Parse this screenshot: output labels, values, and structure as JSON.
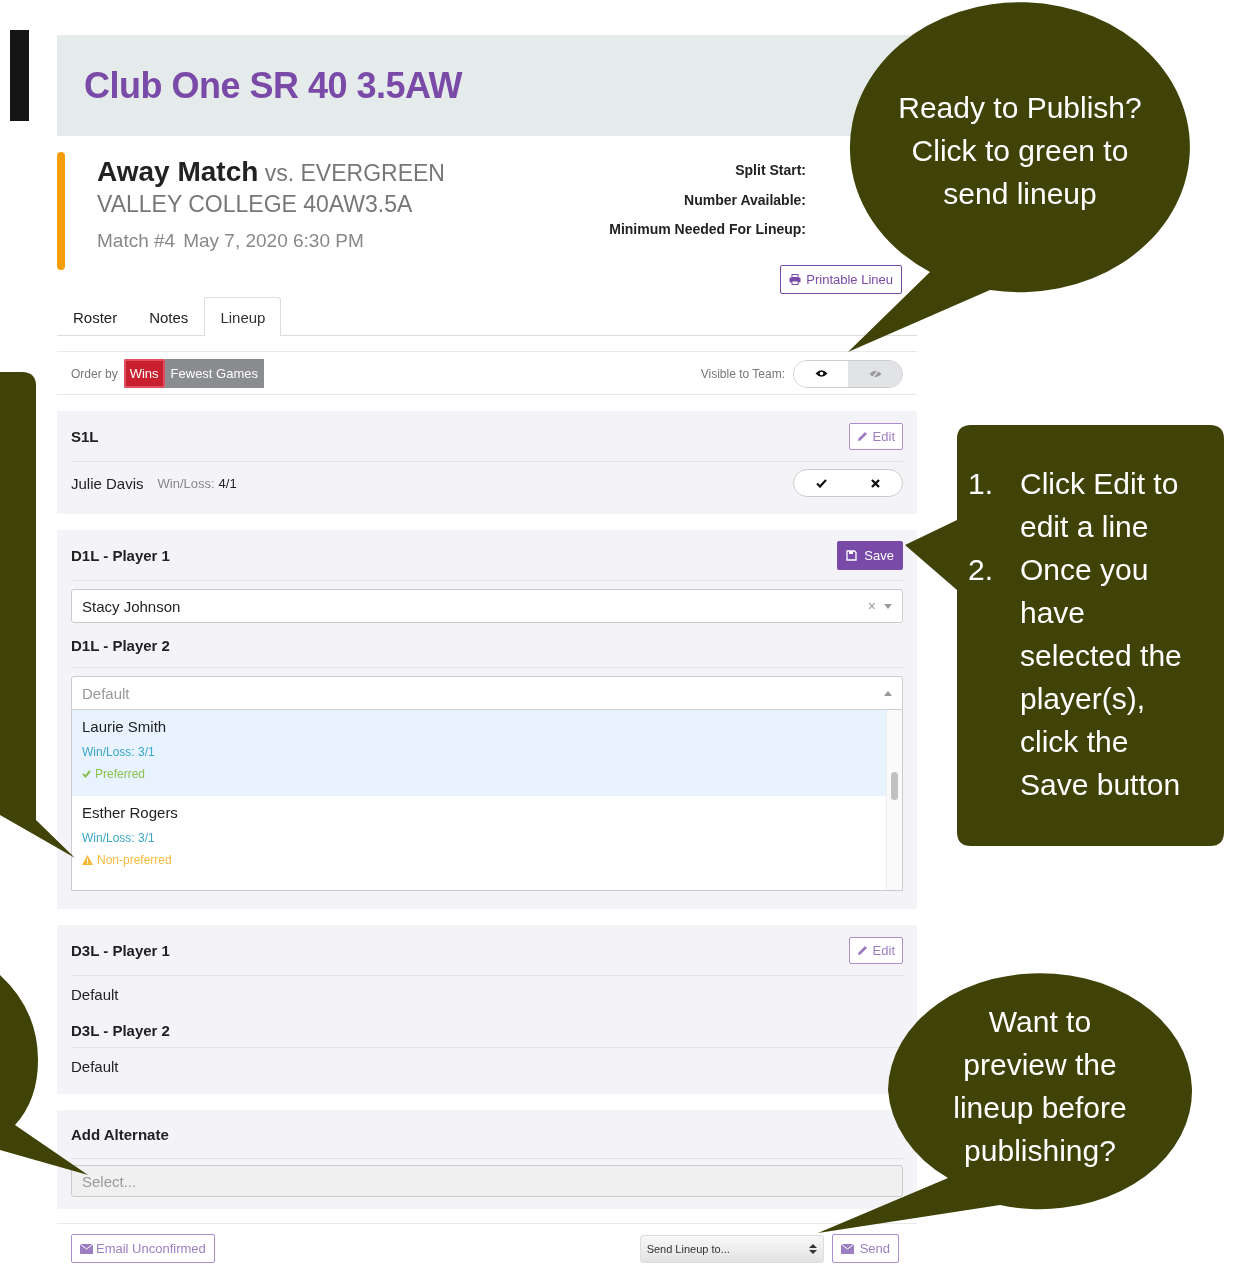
{
  "header": {
    "title": "Club One SR 40 3.5AW"
  },
  "match": {
    "type": "Away Match",
    "opponent": "vs. EVERGREEN VALLEY COLLEGE 40AW3.5A",
    "number": "Match #4",
    "date": "May 7, 2020 6:30 PM"
  },
  "info_labels": [
    "Split Start:",
    "Number Available:",
    "Minimum Needed For Lineup:"
  ],
  "print_button": "Printable Lineu",
  "tabs": [
    {
      "label": "Roster",
      "selected": false
    },
    {
      "label": "Notes",
      "selected": false
    },
    {
      "label": "Lineup",
      "selected": true
    }
  ],
  "order_by": {
    "label": "Order by",
    "options": [
      {
        "label": "Wins",
        "selected": true
      },
      {
        "label": "Fewest Games",
        "selected": false
      }
    ]
  },
  "visible_to_team": {
    "label": "Visible to Team:",
    "on": true
  },
  "s1l": {
    "title": "S1L",
    "edit": "Edit",
    "player": "Julie Davis",
    "record_label": "Win/Loss:",
    "record": "4/1"
  },
  "d1l": {
    "save": "Save",
    "player1": {
      "title": "D1L - Player 1",
      "value": "Stacy Johnson",
      "clear": "×"
    },
    "player2": {
      "title": "D1L - Player 2",
      "placeholder": "Default"
    },
    "options": [
      {
        "name": "Laurie Smith",
        "record": "Win/Loss: 3/1",
        "status": "Preferred",
        "kind": "preferred",
        "selected": true
      },
      {
        "name": "Esther Rogers",
        "record": "Win/Loss: 3/1",
        "status": "Non-preferred",
        "kind": "non-preferred",
        "selected": false
      }
    ]
  },
  "d3l": {
    "edit": "Edit",
    "rows": [
      {
        "title": "D3L - Player 1",
        "value": "Default"
      },
      {
        "title": "D3L - Player 2",
        "value": "Default"
      }
    ]
  },
  "alternate": {
    "title": "Add Alternate",
    "placeholder": "Select..."
  },
  "footer": {
    "email": "Email Unconfirmed",
    "send_to": "Send Lineup to...",
    "send": "Send"
  },
  "callouts": [
    {
      "kind": "bubble",
      "lines": [
        "Ready to Publish?",
        "Click to green to",
        "send lineup"
      ]
    },
    {
      "kind": "list",
      "items": [
        {
          "number": "1.",
          "lines": [
            "Click Edit to",
            "edit a line"
          ]
        },
        {
          "number": "2.",
          "lines": [
            "Once you",
            "have",
            "selected the",
            "player(s),",
            "click the",
            "Save button"
          ]
        }
      ]
    },
    {
      "kind": "bubble",
      "lines": [
        "Want to",
        "preview the",
        "lineup before",
        "publishing?"
      ]
    }
  ]
}
